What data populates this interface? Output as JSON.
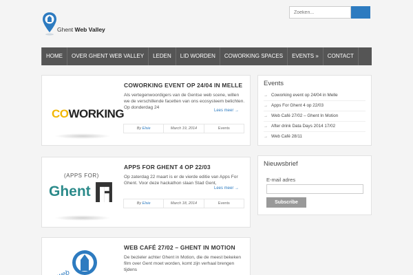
{
  "header": {
    "logo": {
      "text_plain": "Ghent ",
      "text_bold": "Web Valley"
    },
    "search": {
      "placeholder": "Zoeken..."
    }
  },
  "nav": {
    "items": [
      {
        "label": "Home"
      },
      {
        "label": "Over Ghent Web Valley"
      },
      {
        "label": "Leden"
      },
      {
        "label": "Lid worden"
      },
      {
        "label": "Coworking spaces"
      },
      {
        "label": "Events »"
      },
      {
        "label": "Contact"
      }
    ]
  },
  "posts": [
    {
      "title": "Coworking event op 24/04 in Melle",
      "excerpt": "Als vertegenwoordigers van de Gentse web scene, willen we de verschillende facetten van ons ecosysteem belichten. Op donderdag 24",
      "read_more": "Lees meer →",
      "author_prefix": "By",
      "author": "Elsie",
      "date": "March 19, 2014",
      "category": "Events",
      "image_text_a": "CO",
      "image_text_b": "WORKING"
    },
    {
      "title": "Apps for Ghent 4 op 22/03",
      "excerpt": "Op zaterdag 22 maart is er de vierde editie van Apps For Ghent. Voor deze hackathon slaan Stad Gent,",
      "read_more": "Lees meer →",
      "author_prefix": "By",
      "author": "Elsie",
      "date": "March 18, 2014",
      "category": "Events",
      "image_text_a": "(APPS FOR)",
      "image_text_b": "Ghent"
    },
    {
      "title": "Web Café 27/02 – Ghent in Motion",
      "excerpt": "De bezieler achter Ghent in Motion, die de meest bekeken film over Gent moet worden, komt zijn verhaal brengen tijdens",
      "image_text_a": "web"
    }
  ],
  "sidebar": {
    "events": {
      "title": "Events",
      "items": [
        {
          "label": "Coworking event op 24/04 in Melle"
        },
        {
          "label": "Apps For Ghent 4 op 22/03"
        },
        {
          "label": "Web Café 27/02 – Ghent In Motion"
        },
        {
          "label": "After drink Data Days 2014 17/02"
        },
        {
          "label": "Web Café 28/11"
        }
      ]
    },
    "newsletter": {
      "title": "Nieuwsbrief",
      "email_label": "E-mail adres",
      "button_label": "Subscribe"
    }
  },
  "colors": {
    "accent": "#2d7bc0",
    "nav_bg": "#555555",
    "coworking_yellow": "#f2b705"
  }
}
